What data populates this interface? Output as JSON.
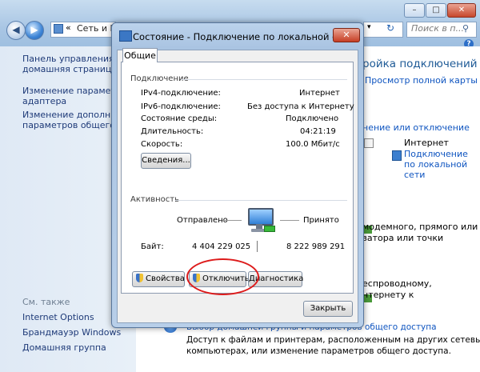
{
  "explorer": {
    "address_crumb": "Сеть и Ин",
    "search_placeholder": "Поиск в п...",
    "left_pane": {
      "items": [
        {
          "line1": "Панель управления -",
          "line2": "домашняя страница"
        },
        {
          "line1": "Изменение параметров",
          "line2": "адаптера"
        },
        {
          "line1": "Изменение дополнительн",
          "line2": "параметров общего дост"
        }
      ],
      "see_also": "См. также",
      "see_also_links": [
        "Internet Options",
        "Брандмауэр Windows",
        "Домашняя группа"
      ]
    },
    "right_pane": {
      "heading": "ройка подключений",
      "view_full_map": "Просмотр полной карты",
      "connect_disconnect": "нение или отключение",
      "access_type_value": "Интернет",
      "connection_link_l1": "Подключение",
      "connection_link_l2": "по локальной",
      "connection_link_l3": "сети",
      "text1": "модемного, прямого или",
      "text2": "затора или точки",
      "text3": "еспроводному,",
      "text4": "нтернету к",
      "bottom_link": "Выбор домашней группы и параметров общего доступа",
      "bottom_text1": "Доступ к файлам и принтерам, расположенным на других сетевых",
      "bottom_text2": "компьютерах, или изменение параметров общего доступа."
    }
  },
  "dialog": {
    "title": "Состояние - Подключение по локальной сети",
    "close": "✕",
    "tab": "Общие",
    "connection_group": "Подключение",
    "rows": [
      {
        "label": "IPv4-подключение:",
        "value": "Интернет"
      },
      {
        "label": "IPv6-подключение:",
        "value": "Без доступа к Интернету"
      },
      {
        "label": "Состояние среды:",
        "value": "Подключено"
      },
      {
        "label": "Длительность:",
        "value": "04:21:19"
      },
      {
        "label": "Скорость:",
        "value": "100.0 Мбит/с"
      }
    ],
    "details_button": "Сведения...",
    "activity_group": "Активность",
    "sent_label": "Отправлено",
    "received_label": "Принято",
    "bytes_label": "Байт:",
    "bytes_sent": "4 404 229 025",
    "bytes_received": "8 222 989 291",
    "properties_button": "Свойства",
    "disable_button": "Отключить",
    "diagnose_button": "Диагностика",
    "close_button": "Закрыть"
  }
}
